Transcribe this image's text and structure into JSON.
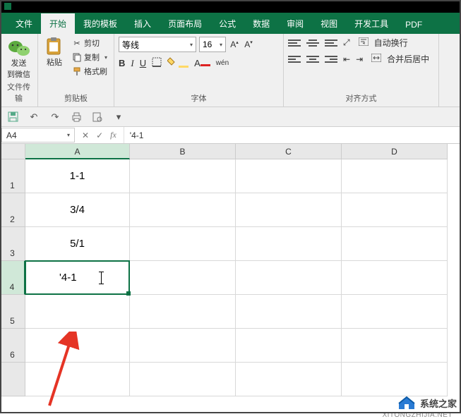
{
  "tabs": {
    "file": "文件",
    "home": "开始",
    "template": "我的模板",
    "insert": "插入",
    "layout": "页面布局",
    "formula": "公式",
    "data": "数据",
    "review": "审阅",
    "view": "视图",
    "dev": "开发工具",
    "pdf": "PDF"
  },
  "ribbon": {
    "wechat": {
      "line1": "发送",
      "line2": "到微信",
      "group": "文件传输"
    },
    "clipboard": {
      "paste": "粘贴",
      "cut": "剪切",
      "copy": "复制",
      "format": "格式刷",
      "group": "剪贴板"
    },
    "font": {
      "name": "等线",
      "size": "16",
      "group": "字体"
    },
    "align": {
      "wrap": "自动换行",
      "merge": "合并后居中",
      "group": "对齐方式"
    }
  },
  "formula_bar": {
    "name_box": "A4",
    "value": "'4-1"
  },
  "columns": [
    "A",
    "B",
    "C",
    "D"
  ],
  "rows": [
    "1",
    "2",
    "3",
    "4",
    "5",
    "6"
  ],
  "cells": {
    "A1": "1-1",
    "A2": "3/4",
    "A3": "5/1",
    "A4": "'4-1"
  },
  "watermark": {
    "text": "系统之家",
    "url": "XITONGZHIJIA.NET"
  }
}
